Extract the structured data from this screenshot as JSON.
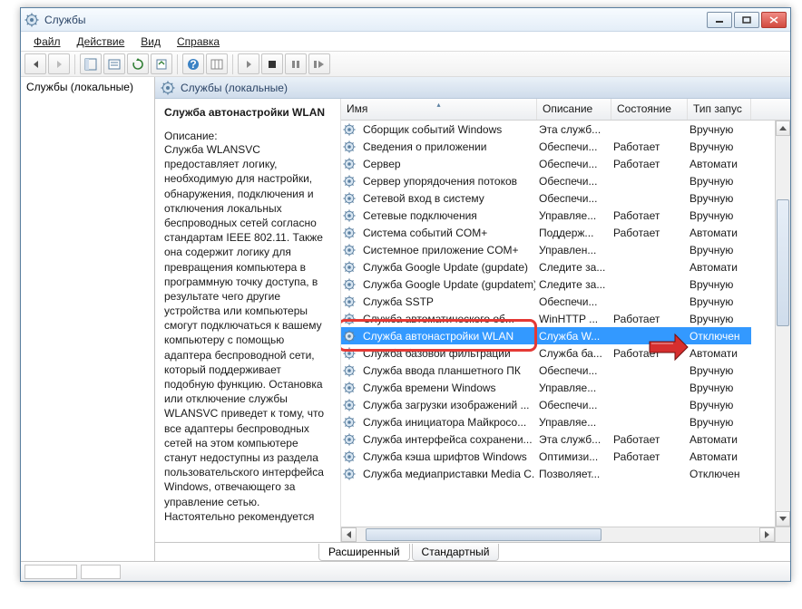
{
  "window": {
    "title": "Службы"
  },
  "menu": {
    "file": "Файл",
    "action": "Действие",
    "view": "Вид",
    "help": "Справка"
  },
  "tree": {
    "root": "Службы (локальные)"
  },
  "pane_header": "Службы (локальные)",
  "detail": {
    "title": "Служба автонастройки WLAN",
    "desc_label": "Описание:",
    "desc_text": "Служба WLANSVC предоставляет логику, необходимую для настройки, обнаружения, подключения и отключения локальных беспроводных сетей согласно стандартам IEEE 802.11. Также она содержит логику для превращения компьютера в программную точку доступа, в результате чего другие устройства или компьютеры смогут подключаться к вашему компьютеру с помощью адаптера беспроводной сети, который поддерживает подобную функцию. Остановка или отключение службы WLANSVC приведет к тому, что все адаптеры беспроводных сетей на этом компьютере станут недоступны из раздела пользовательского интерфейса Windows, отвечающего за управление сетью. Настоятельно рекомендуется"
  },
  "columns": {
    "name": "Имя",
    "desc": "Описание",
    "state": "Состояние",
    "start": "Тип запус"
  },
  "rows": [
    {
      "name": "Сборщик событий Windows",
      "desc": "Эта служб...",
      "state": "",
      "start": "Вручную"
    },
    {
      "name": "Сведения о приложении",
      "desc": "Обеспечи...",
      "state": "Работает",
      "start": "Вручную"
    },
    {
      "name": "Сервер",
      "desc": "Обеспечи...",
      "state": "Работает",
      "start": "Автомати"
    },
    {
      "name": "Сервер упорядочения потоков",
      "desc": "Обеспечи...",
      "state": "",
      "start": "Вручную"
    },
    {
      "name": "Сетевой вход в систему",
      "desc": "Обеспечи...",
      "state": "",
      "start": "Вручную"
    },
    {
      "name": "Сетевые подключения",
      "desc": "Управляе...",
      "state": "Работает",
      "start": "Вручную"
    },
    {
      "name": "Система событий COM+",
      "desc": "Поддерж...",
      "state": "Работает",
      "start": "Автомати"
    },
    {
      "name": "Системное приложение COM+",
      "desc": "Управлен...",
      "state": "",
      "start": "Вручную"
    },
    {
      "name": "Служба Google Update (gupdate)",
      "desc": "Следите за...",
      "state": "",
      "start": "Автомати"
    },
    {
      "name": "Служба Google Update (gupdatem)",
      "desc": "Следите за...",
      "state": "",
      "start": "Вручную"
    },
    {
      "name": "Служба SSTP",
      "desc": "Обеспечи...",
      "state": "",
      "start": "Вручную"
    },
    {
      "name": "Служба автоматического об...",
      "desc": "WinHTTP ...",
      "state": "Работает",
      "start": "Вручную"
    },
    {
      "name": "Служба автонастройки WLAN",
      "desc": "Служба W...",
      "state": "",
      "start": "Отключен",
      "selected": true
    },
    {
      "name": "Служба базовой фильтрации",
      "desc": "Служба ба...",
      "state": "Работает",
      "start": "Автомати"
    },
    {
      "name": "Служба ввода планшетного ПК",
      "desc": "Обеспечи...",
      "state": "",
      "start": "Вручную"
    },
    {
      "name": "Служба времени Windows",
      "desc": "Управляе...",
      "state": "",
      "start": "Вручную"
    },
    {
      "name": "Служба загрузки изображений ...",
      "desc": "Обеспечи...",
      "state": "",
      "start": "Вручную"
    },
    {
      "name": "Служба инициатора Майкросо...",
      "desc": "Управляе...",
      "state": "",
      "start": "Вручную"
    },
    {
      "name": "Служба интерфейса сохранени...",
      "desc": "Эта служб...",
      "state": "Работает",
      "start": "Автомати"
    },
    {
      "name": "Служба кэша шрифтов Windows",
      "desc": "Оптимизи...",
      "state": "Работает",
      "start": "Автомати"
    },
    {
      "name": "Служба медиаприставки Media C...",
      "desc": "Позволяет...",
      "state": "",
      "start": "Отключен"
    }
  ],
  "tabs": {
    "extended": "Расширенный",
    "standard": "Стандартный"
  }
}
